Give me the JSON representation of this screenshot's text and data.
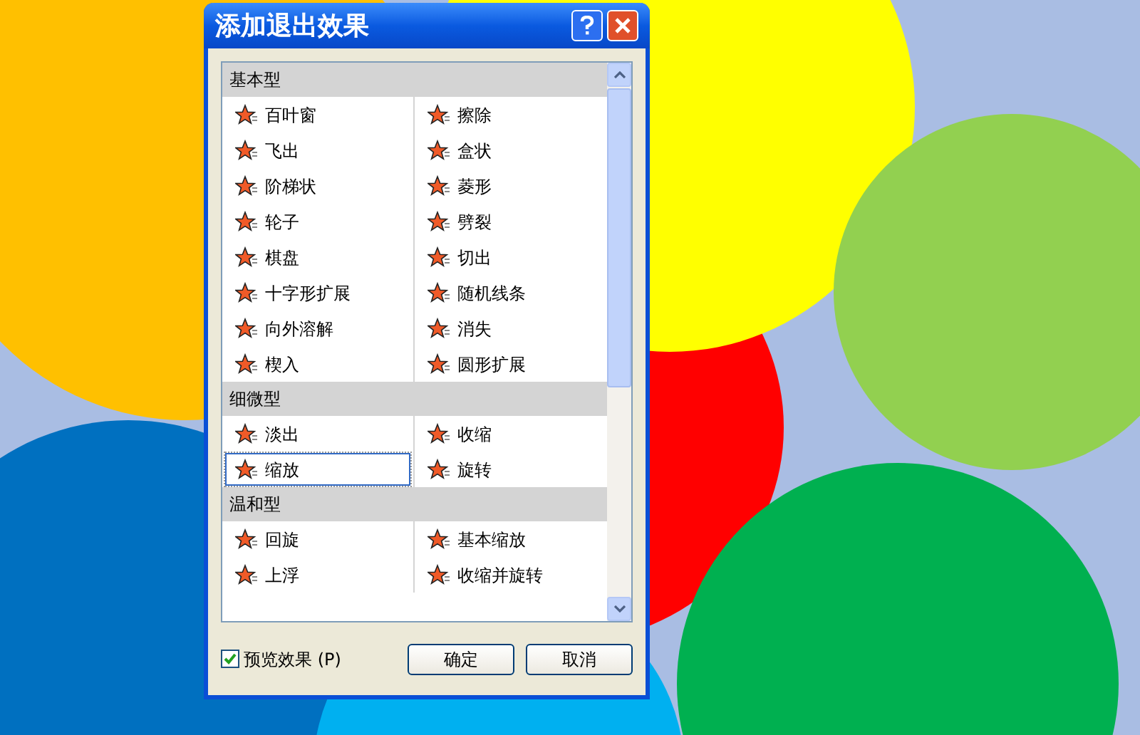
{
  "dialog": {
    "title": "添加退出效果",
    "groups": [
      {
        "label": "基本型",
        "effects": [
          {
            "label": "百叶窗",
            "selected": false
          },
          {
            "label": "擦除",
            "selected": false
          },
          {
            "label": "飞出",
            "selected": false
          },
          {
            "label": "盒状",
            "selected": false
          },
          {
            "label": "阶梯状",
            "selected": false
          },
          {
            "label": "菱形",
            "selected": false
          },
          {
            "label": "轮子",
            "selected": false
          },
          {
            "label": "劈裂",
            "selected": false
          },
          {
            "label": "棋盘",
            "selected": false
          },
          {
            "label": "切出",
            "selected": false
          },
          {
            "label": "十字形扩展",
            "selected": false
          },
          {
            "label": "随机线条",
            "selected": false
          },
          {
            "label": "向外溶解",
            "selected": false
          },
          {
            "label": "消失",
            "selected": false
          },
          {
            "label": "楔入",
            "selected": false
          },
          {
            "label": "圆形扩展",
            "selected": false
          }
        ]
      },
      {
        "label": "细微型",
        "effects": [
          {
            "label": "淡出",
            "selected": false
          },
          {
            "label": "收缩",
            "selected": false
          },
          {
            "label": "缩放",
            "selected": true
          },
          {
            "label": "旋转",
            "selected": false
          }
        ]
      },
      {
        "label": "温和型",
        "effects": [
          {
            "label": "回旋",
            "selected": false
          },
          {
            "label": "基本缩放",
            "selected": false
          },
          {
            "label": "上浮",
            "selected": false
          },
          {
            "label": "收缩并旋转",
            "selected": false
          }
        ]
      }
    ],
    "preview": {
      "label": "预览效果 (P)",
      "checked": true
    },
    "buttons": [
      "确定",
      "取消"
    ]
  }
}
